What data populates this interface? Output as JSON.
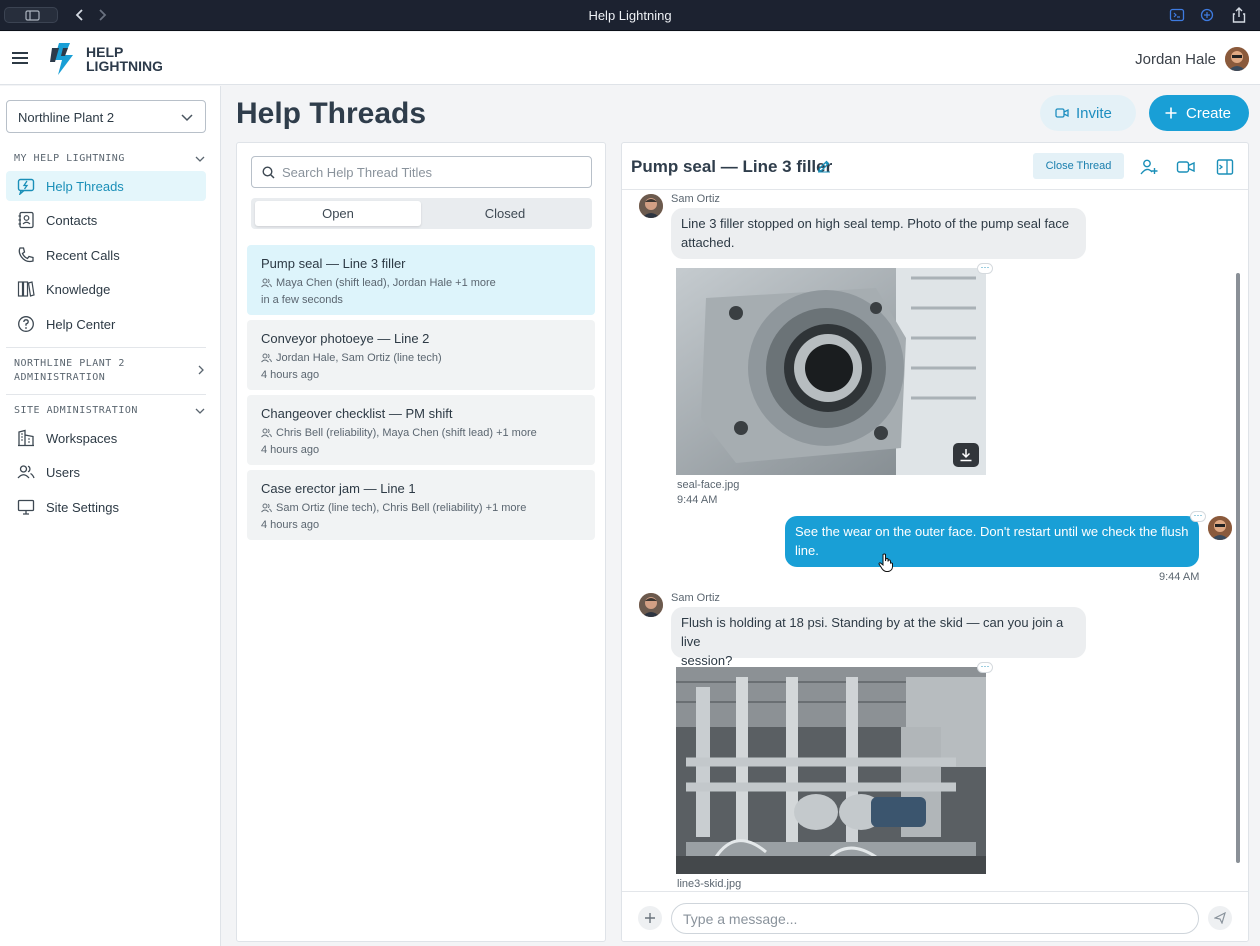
{
  "window": {
    "title": "Help Lightning"
  },
  "header": {
    "logo_text_1": "HELP",
    "logo_text_2": "LIGHTNING",
    "user_name": "Jordan Hale"
  },
  "sidebar": {
    "workspace": "Northline Plant 2",
    "section_my": "MY HELP LIGHTNING",
    "items": [
      {
        "label": "Help Threads",
        "icon": "threads-icon"
      },
      {
        "label": "Contacts",
        "icon": "contacts-icon"
      },
      {
        "label": "Recent Calls",
        "icon": "phone-icon"
      },
      {
        "label": "Knowledge",
        "icon": "knowledge-icon"
      },
      {
        "label": "Help Center",
        "icon": "help-icon"
      }
    ],
    "section_plant_admin_1": "NORTHLINE PLANT 2",
    "section_plant_admin_2": "ADMINISTRATION",
    "section_site": "SITE ADMINISTRATION",
    "site_items": [
      {
        "label": "Workspaces",
        "icon": "buildings-icon"
      },
      {
        "label": "Users",
        "icon": "users-icon"
      },
      {
        "label": "Site Settings",
        "icon": "monitor-icon"
      }
    ]
  },
  "main": {
    "title": "Help Threads",
    "invite_label": "Invite",
    "create_label": "Create"
  },
  "threads": {
    "search_placeholder": "Search Help Thread Titles",
    "tab_open": "Open",
    "tab_closed": "Closed",
    "list": [
      {
        "title": "Pump seal — Line 3 filler",
        "participants": "Maya Chen (shift lead), Jordan Hale +1 more",
        "time": "in a few seconds"
      },
      {
        "title": "Conveyor photoeye — Line 2",
        "participants": "Jordan Hale, Sam Ortiz (line tech)",
        "time": "4 hours ago"
      },
      {
        "title": "Changeover checklist — PM shift",
        "participants": "Chris Bell (reliability), Maya Chen (shift lead) +1 more",
        "time": "4 hours ago"
      },
      {
        "title": "Case erector jam — Line 1",
        "participants": "Sam Ortiz (line tech), Chris Bell (reliability) +1 more",
        "time": "4 hours ago"
      }
    ]
  },
  "chat": {
    "title": "Pump seal — Line 3 filler",
    "close_label": "Close Thread",
    "messages": [
      {
        "sender": "Sam Ortiz",
        "line1": "Line 3 filler stopped on high seal temp. Photo of the pump seal face",
        "line2": "attached."
      },
      {
        "file": "seal-face.jpg",
        "time": "9:44 AM"
      },
      {
        "line1": "See the wear on the outer face. Don't restart until we check the flush",
        "line2": "line.",
        "time": "9:44 AM"
      },
      {
        "sender": "Sam Ortiz",
        "line1": "Flush is holding at 18 psi. Standing by at the skid — can you join a live",
        "line2": "session?"
      },
      {
        "file": "line3-skid.jpg"
      }
    ],
    "input_placeholder": "Type a message..."
  },
  "colors": {
    "accent": "#199fd6",
    "active_bg": "#ddf4fb",
    "titlebar": "#1c2230"
  }
}
